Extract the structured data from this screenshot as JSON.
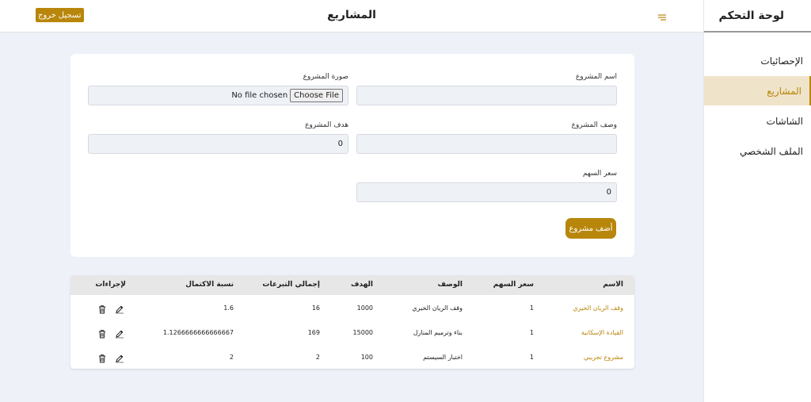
{
  "sidebar": {
    "title": "لوحة التحكم",
    "items": [
      {
        "label": "الإحصائيات"
      },
      {
        "label": "المشاريع"
      },
      {
        "label": "الشاشات"
      },
      {
        "label": "الملف الشخصي"
      }
    ]
  },
  "header": {
    "title": "المشاريع",
    "logout_label": "تسجيل خروج"
  },
  "form": {
    "name_label": "اسم المشروع",
    "name_value": "",
    "image_label": "صورة المشروع",
    "file_button": "Choose File",
    "file_status": "No file chosen",
    "description_label": "وصف المشروع",
    "description_value": "",
    "goal_label": "هدف المشروع",
    "goal_value": "0",
    "share_price_label": "سعر السهم",
    "share_price_value": "0",
    "add_button": "أضف مشروع"
  },
  "table": {
    "headers": {
      "name": "الاسم",
      "share_price": "سعر السهم",
      "description": "الوصف",
      "goal": "الهدف",
      "donations": "إجمالي التبرعات",
      "completion": "نسبة الاكتمال",
      "actions": "لإجراءات"
    },
    "rows": [
      {
        "name": "وقف الريان الخيري",
        "share_price": "1",
        "description": "وقف الريان الخيري",
        "goal": "1000",
        "donations": "16",
        "completion": "1.6"
      },
      {
        "name": "القيادة الإسكانية",
        "share_price": "1",
        "description": "بناء وترميم المنازل",
        "goal": "15000",
        "donations": "169",
        "completion": "1.1266666666666667"
      },
      {
        "name": "مشروع تجريبي",
        "share_price": "1",
        "description": "اختبار السيستم",
        "goal": "100",
        "donations": "2",
        "completion": "2"
      }
    ]
  },
  "colors": {
    "accent": "#b8860b",
    "active_bg": "#efe3c9",
    "page_bg": "#eef1f7"
  }
}
